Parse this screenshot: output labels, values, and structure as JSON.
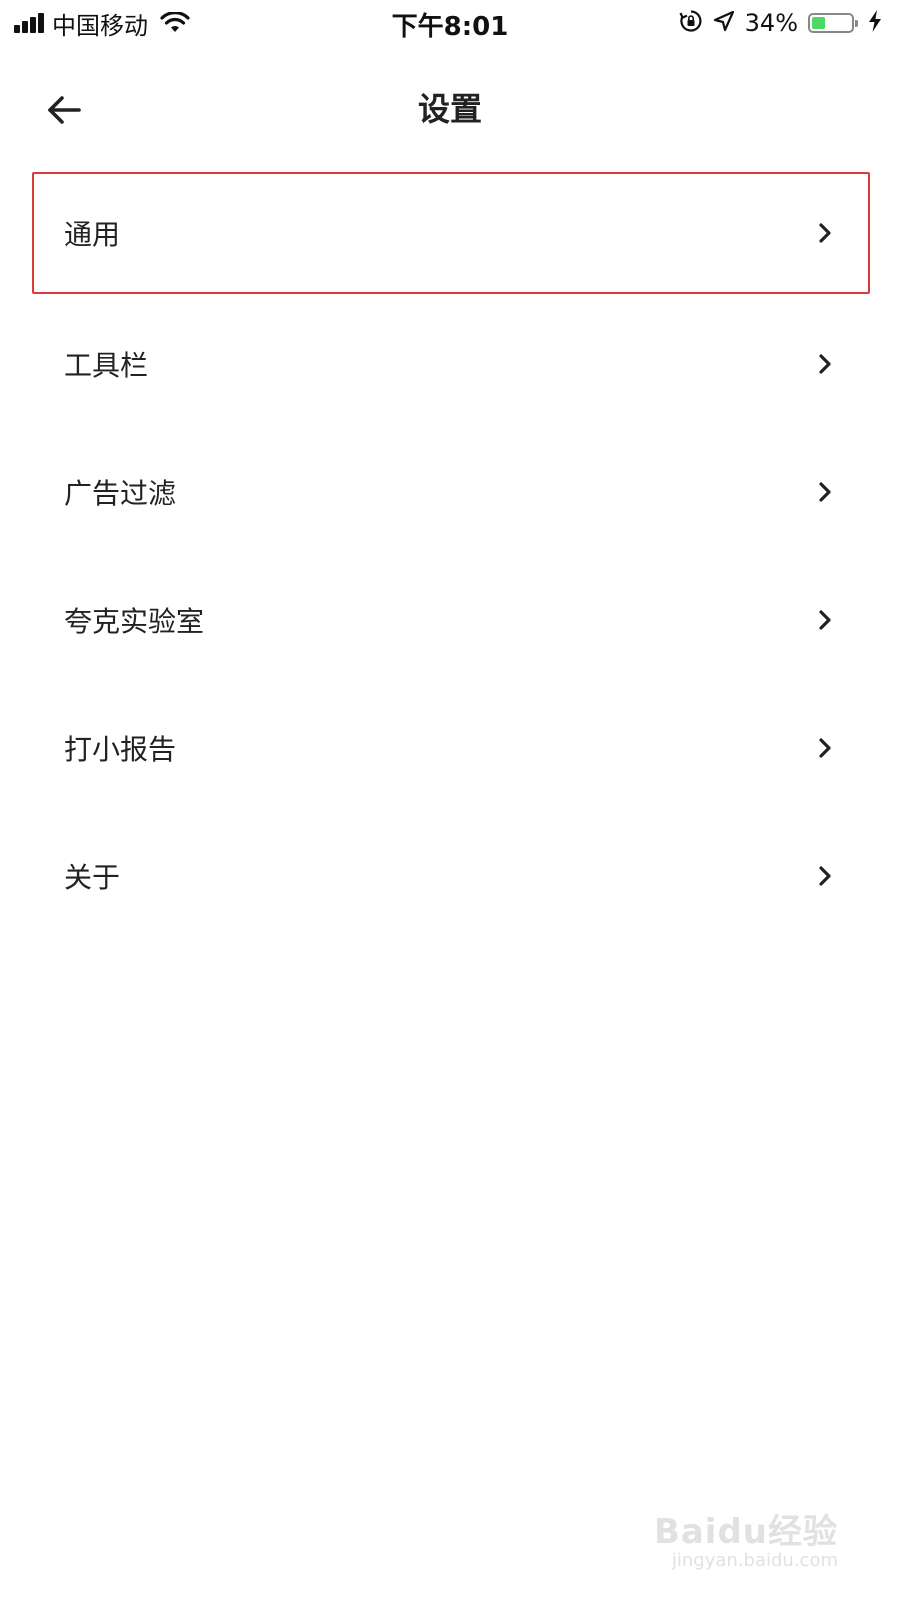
{
  "status_bar": {
    "carrier": "中国移动",
    "time": "下午8:01",
    "battery_percent_text": "34%",
    "battery_level": 0.34,
    "icons": [
      "signal-bars-icon",
      "wifi-icon",
      "rotation-lock-icon",
      "location-arrow-icon",
      "battery-icon",
      "charging-bolt-icon"
    ]
  },
  "nav": {
    "back_icon": "arrow-left-icon",
    "title": "设置"
  },
  "settings": {
    "items": [
      {
        "label": "通用",
        "highlighted": true
      },
      {
        "label": "工具栏"
      },
      {
        "label": "广告过滤"
      },
      {
        "label": "夸克实验室"
      },
      {
        "label": "打小报告"
      },
      {
        "label": "关于"
      }
    ],
    "chevron_icon": "chevron-right-icon",
    "highlight_color": "#d93a3a"
  },
  "watermark": {
    "main": "Baidu经验",
    "sub": "jingyan.baidu.com"
  },
  "colors": {
    "battery_green": "#4cd964",
    "text": "#222222",
    "background": "#ffffff"
  }
}
